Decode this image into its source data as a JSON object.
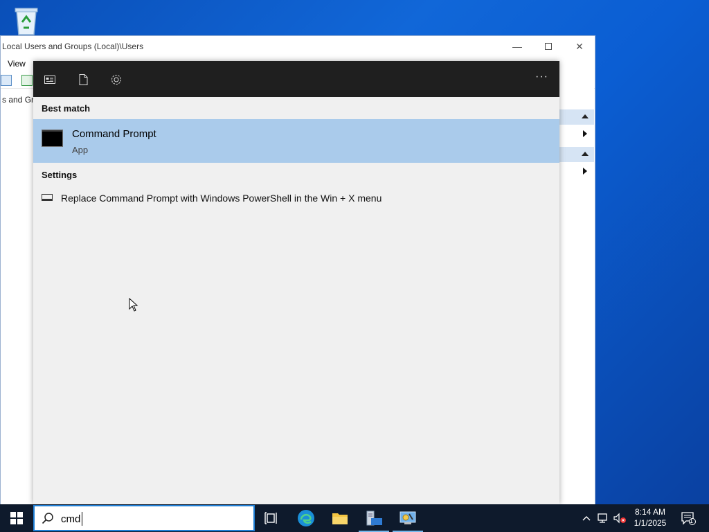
{
  "window": {
    "title": "Local Users and Groups (Local)\\Users",
    "menu_view": "View",
    "tree_item": "s and Grou"
  },
  "search_panel": {
    "best_match_label": "Best match",
    "best_match": {
      "title": "Command Prompt",
      "subtitle": "App",
      "icon": "command-prompt-icon"
    },
    "settings_label": "Settings",
    "settings_item": {
      "text": "Replace Command Prompt with Windows PowerShell in the Win + X menu",
      "icon": "settings-display-icon"
    },
    "more_label": "···"
  },
  "taskbar": {
    "search_value": "cmd",
    "clock_time": "8:14 AM",
    "clock_date": "1/1/2025",
    "notification_count": "1"
  },
  "colors": {
    "accent": "#1e7fd6",
    "highlight": "#aacbeb",
    "panel_header": "#1f1f1f",
    "panel_bg": "#f0f0f0"
  }
}
